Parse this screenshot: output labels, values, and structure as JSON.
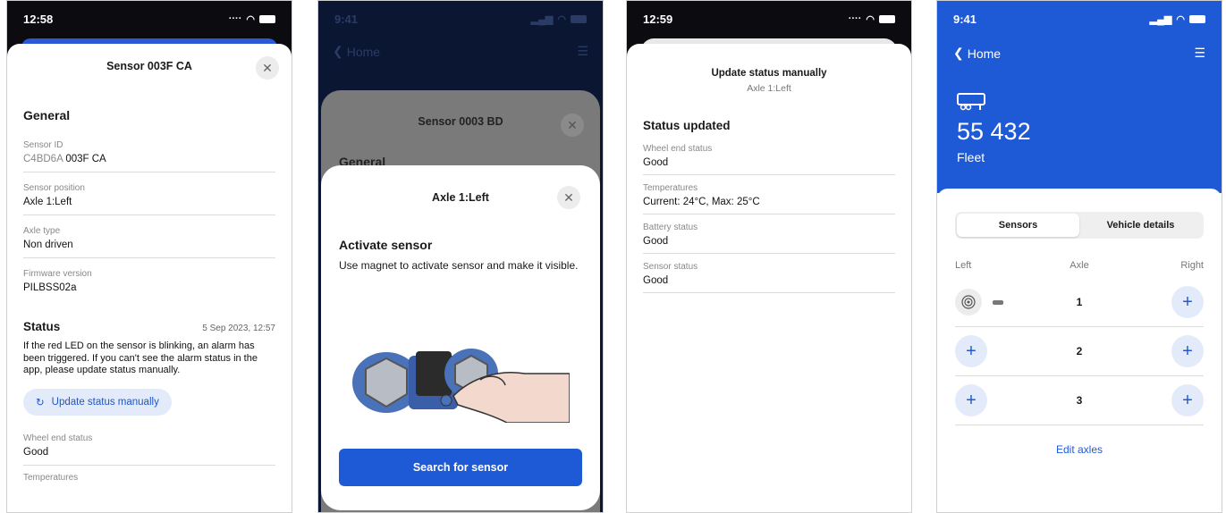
{
  "screen1": {
    "time": "12:58",
    "title": "Sensor 003F CA",
    "general_heading": "General",
    "fields": [
      {
        "label": "Sensor ID",
        "value_muted": "C4BD6A",
        "value": "003F CA"
      },
      {
        "label": "Sensor position",
        "value": "Axle 1:Left"
      },
      {
        "label": "Axle type",
        "value": "Non driven"
      },
      {
        "label": "Firmware version",
        "value": "PILBSS02a"
      }
    ],
    "status_heading": "Status",
    "status_date": "5 Sep 2023, 12:57",
    "status_text": "If the red LED on the sensor is blinking, an alarm has been triggered. If you can't see the alarm status in the app, please update status manually.",
    "update_button": "Update status manually",
    "wheel_label": "Wheel end status",
    "wheel_value": "Good",
    "next_label": "Temperatures"
  },
  "screen2": {
    "time": "9:41",
    "back": "Home",
    "under_title": "Sensor 0003 BD",
    "under_general": "General",
    "modal_title": "Axle 1:Left",
    "heading": "Activate sensor",
    "text": "Use magnet to activate sensor and make it visible.",
    "button": "Search for sensor"
  },
  "screen3": {
    "time": "12:59",
    "title": "Update status manually",
    "subtitle": "Axle 1:Left",
    "heading": "Status updated",
    "fields": [
      {
        "label": "Wheel end status",
        "value": "Good"
      },
      {
        "label": "Temperatures",
        "value": "Current: 24°C, Max: 25°C"
      },
      {
        "label": "Battery status",
        "value": "Good"
      },
      {
        "label": "Sensor status",
        "value": "Good"
      }
    ]
  },
  "screen4": {
    "time": "9:41",
    "back": "Home",
    "vehicle_number": "55 432",
    "fleet": "Fleet",
    "tabs": [
      "Sensors",
      "Vehicle details"
    ],
    "col_left": "Left",
    "col_axle": "Axle",
    "col_right": "Right",
    "axles": [
      "1",
      "2",
      "3"
    ],
    "edit": "Edit axles"
  },
  "colors": {
    "accent": "#1f5ad6",
    "accent_light": "#e3ebfb"
  }
}
